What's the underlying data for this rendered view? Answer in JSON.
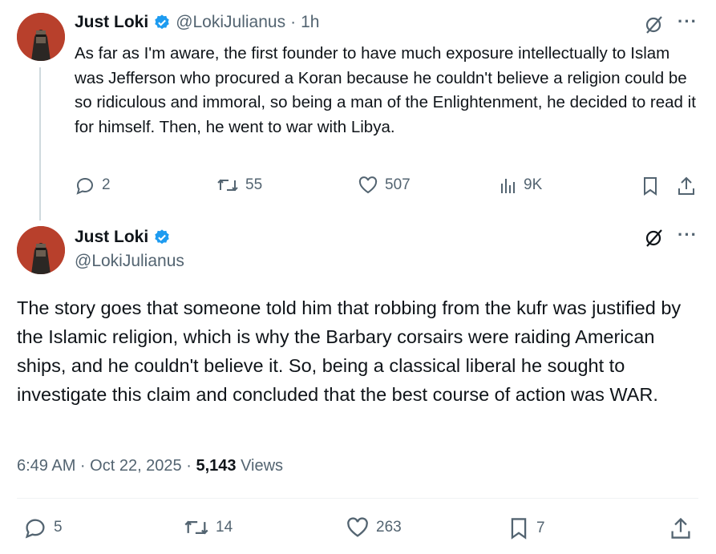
{
  "tweet1": {
    "name": "Just Loki",
    "handle": "@LokiJulianus",
    "separator": "·",
    "time": "1h",
    "text": "As far as I'm aware, the first founder to have much exposure intellectually to Islam was Jefferson who procured a Koran because he couldn't believe a religion could be so ridiculous and immoral, so being a man of the Enlightenment, he decided to read it for himself. Then, he went to war with Libya.",
    "replies": "2",
    "reposts": "55",
    "likes": "507",
    "views": "9K"
  },
  "tweet2": {
    "name": "Just Loki",
    "handle": "@LokiJulianus",
    "text": "The story goes that someone told him that robbing from the kufr was justified by the Islamic religion, which is why the Barbary corsairs were raiding American ships, and he couldn't believe it. So, being a classical liberal he sought to investigate this claim and concluded that the best course of action was WAR.",
    "timestamp": "6:49 AM · Oct 22, 2025 · ",
    "views_count": "5,143",
    "views_label": " Views",
    "replies": "5",
    "reposts": "14",
    "likes": "263",
    "bookmarks": "7"
  },
  "icons": {
    "verified": "verified-badge-icon",
    "grok": "grok-icon",
    "more": "more-icon",
    "reply": "reply-icon",
    "repost": "repost-icon",
    "like": "heart-icon",
    "views": "views-icon",
    "bookmark": "bookmark-icon",
    "share": "share-icon"
  },
  "colors": {
    "text": "#0f1419",
    "muted": "#536471",
    "verified": "#1d9bf0",
    "thread_line": "#cfd9de"
  }
}
